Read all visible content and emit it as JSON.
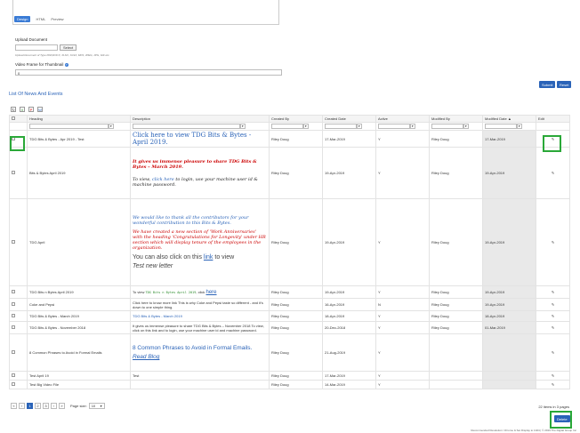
{
  "editor": {
    "tabs": [
      "Design",
      "HTML",
      "Preview"
    ]
  },
  "form": {
    "upload_label": "Upload Document",
    "select_label": "Select",
    "upload_hint": "Upload Document of Type PDF,DOCX, XLSX, XLSX, MP4, JPEG, JPG, GIF etc.",
    "thumb_label": "Video Frame for Thumbnail",
    "thumb_value": "0",
    "submit_label": "Submit",
    "reset_label": "Reset"
  },
  "section_title": "List Of News And Events",
  "columns": [
    "",
    "Heading",
    "Description",
    "Created By",
    "Created Date",
    "Active",
    "Modified By",
    "Modified Date",
    "Edit"
  ],
  "modified_sort_indicator": "▲",
  "rows": [
    {
      "heading": "TDG Bits & Bytes - Apr 2019 - Test",
      "created_by": "Riley Doug",
      "created_date": "17-Mar-2019",
      "active": "Y",
      "modified_by": "Riley Doug",
      "modified_date": "17-Mar-2019"
    },
    {
      "heading": "Bits & Bytes April 2019",
      "created_by": "Riley Doug",
      "created_date": "19-Apr-2019",
      "active": "Y",
      "modified_by": "Riley Doug",
      "modified_date": "19-Apr-2019"
    },
    {
      "heading": "TDG April",
      "created_by": "Riley Doug",
      "created_date": "19-Apr-2019",
      "active": "Y",
      "modified_by": "Riley Doug",
      "modified_date": "19-Apr-2019"
    },
    {
      "heading": "TDG Bits n Bytes April 2019",
      "created_by": "Riley Doug",
      "created_date": "19-Apr-2019",
      "active": "Y",
      "modified_by": "Riley Doug",
      "modified_date": "19-Apr-2019"
    },
    {
      "heading": "Coke and Pepsi",
      "created_by": "Riley Doug",
      "created_date": "16-Apr-2019",
      "active": "N",
      "modified_by": "Riley Doug",
      "modified_date": "19-Apr-2019"
    },
    {
      "heading": "TDG Bits & Bytes - March 2019",
      "created_by": "Riley Doug",
      "created_date": "18-Apr-2019",
      "active": "Y",
      "modified_by": "Riley Doug",
      "modified_date": "18-Apr-2019"
    },
    {
      "heading": "TDG Bits & Bytes - November 2018",
      "created_by": "Riley Doug",
      "created_date": "20-Dec-2018",
      "active": "Y",
      "modified_by": "Riley Doug",
      "modified_date": "01-Mar-2019"
    },
    {
      "heading": "8 Common Phrases to Avoid in Formal Emails",
      "created_by": "Riley Doug",
      "created_date": "21-Aug-2019",
      "active": "Y",
      "modified_by": "",
      "modified_date": ""
    },
    {
      "heading": "Test April 19",
      "created_by": "Riley Doug",
      "created_date": "17-Mar-2019",
      "active": "Y",
      "modified_by": "",
      "modified_date": ""
    },
    {
      "heading": "Test Big Video File",
      "created_by": "Riley Doug",
      "created_date": "14-Mar-2019",
      "active": "Y",
      "modified_by": "",
      "modified_date": ""
    }
  ],
  "desc": {
    "r1": "Click here to view TDG Bits & Bytes - April 2019.",
    "r2_red": "It gives us immense pleasure to share TDG Bits & Bytes – March 2019.",
    "r2_pre": "To view,",
    "r2_link": "click here",
    "r2_post": "to login, use your machine user id & machine password.",
    "r3_a": "We would like to thank all the contributors for your wonderful contribution to this Bits & Bytes.",
    "r3_b": "We have created a new section of 'Work Anniversaries' with the heading 'Congratulations for Longevity' under HR section which will display tenure of the employees in the organization.",
    "r3_c_pre": "You can also click on this",
    "r3_c_link": "link",
    "r3_c_post": "to view",
    "r3_d": "Test new letter",
    "r4_pre": "To view",
    "r4_mono": "TDG Bits n Bytes April 2019",
    "r4_mid": ", click",
    "r4_link": "here",
    "r5": "Click here to know more link This is why Coke and Pepsi taste so different - and it's down to one simple thing.",
    "r6": "TDG Bits & Bytes - March 2019",
    "r7": "It gives us immense pleasure to share TDG Bits & Bytes – November 2018 To view, click on this link and to login, use your machine user id and machine password.",
    "r8_a": "8 Common Phrases to Avoid in Formal Emails.",
    "r8_b": "Read Blog",
    "r9": "Test"
  },
  "pager": {
    "first": "«",
    "prev": "‹",
    "pages": [
      "1",
      "2",
      "3"
    ],
    "next": "›",
    "last": "»",
    "page_size_label": "Page size:",
    "page_size": "10",
    "summary": "22 items in 3 pages"
  },
  "delete_label": "Delete",
  "footer": "Recommended Resolution: Chrome & Set Display to 1024 | © 2019 The Digital Group Inc"
}
